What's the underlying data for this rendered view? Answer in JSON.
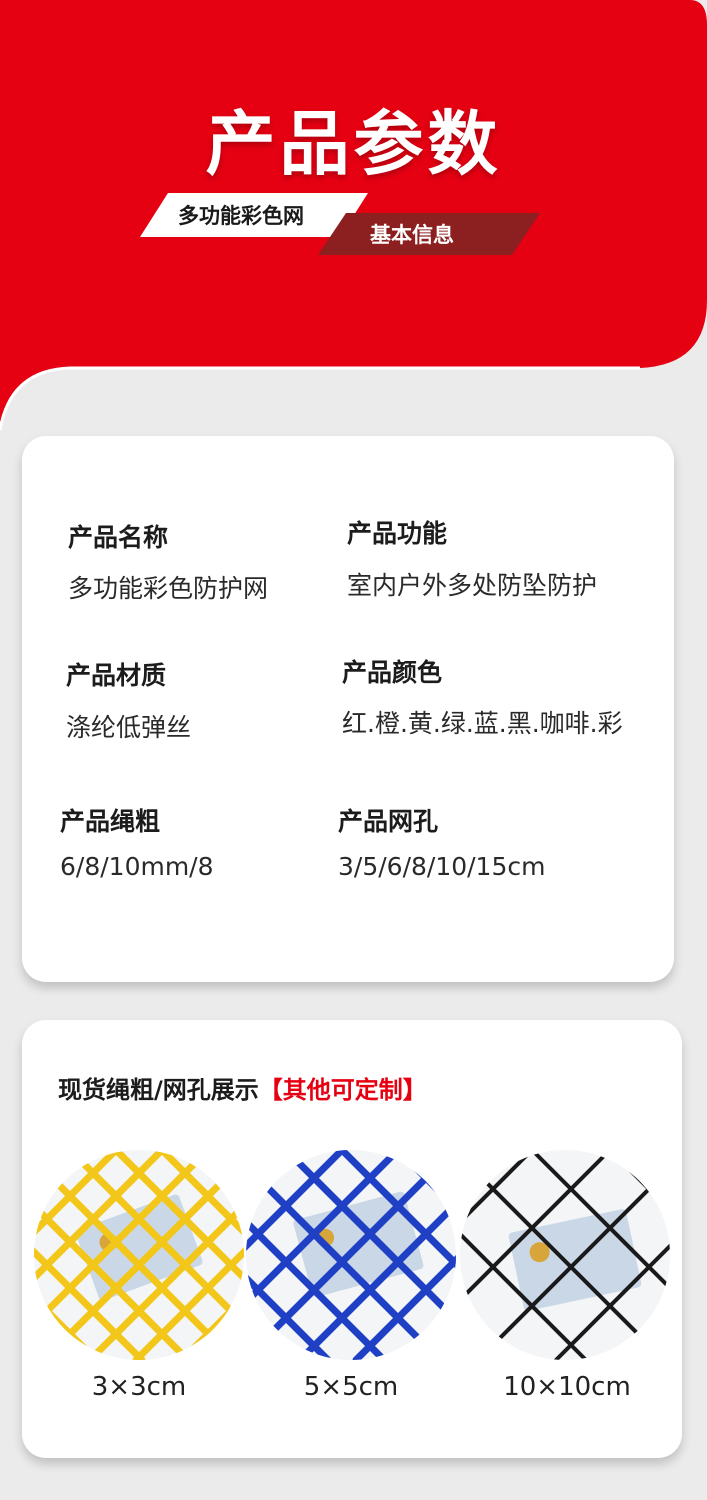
{
  "header": {
    "title": "产品参数",
    "tag_primary": "多功能彩色网",
    "tag_secondary": "基本信息"
  },
  "specs": [
    {
      "label": "产品名称",
      "value": "多功能彩色防护网"
    },
    {
      "label": "产品功能",
      "value": "室内户外多处防坠防护"
    },
    {
      "label": "产品材质",
      "value": "涤纶低弹丝"
    },
    {
      "label": "产品颜色",
      "value": "红.橙.黄.绿.蓝.黑.咖啡.彩"
    },
    {
      "label": "产品绳粗",
      "value": "6/8/10mm/8"
    },
    {
      "label": "产品网孔",
      "value": "3/5/6/8/10/15cm"
    }
  ],
  "showcase": {
    "title": "现货绳粗/网孔展示",
    "title_highlight": "【其他可定制】",
    "samples": [
      {
        "caption": "3×3cm",
        "net_color": "#f3c61a"
      },
      {
        "caption": "5×5cm",
        "net_color": "#1f3fc4"
      },
      {
        "caption": "10×10cm",
        "net_color": "#1a1a1a"
      }
    ]
  },
  "colors": {
    "brand_red": "#e50012",
    "tag_dark": "#8c1f1f",
    "page_bg": "#ebebeb"
  }
}
